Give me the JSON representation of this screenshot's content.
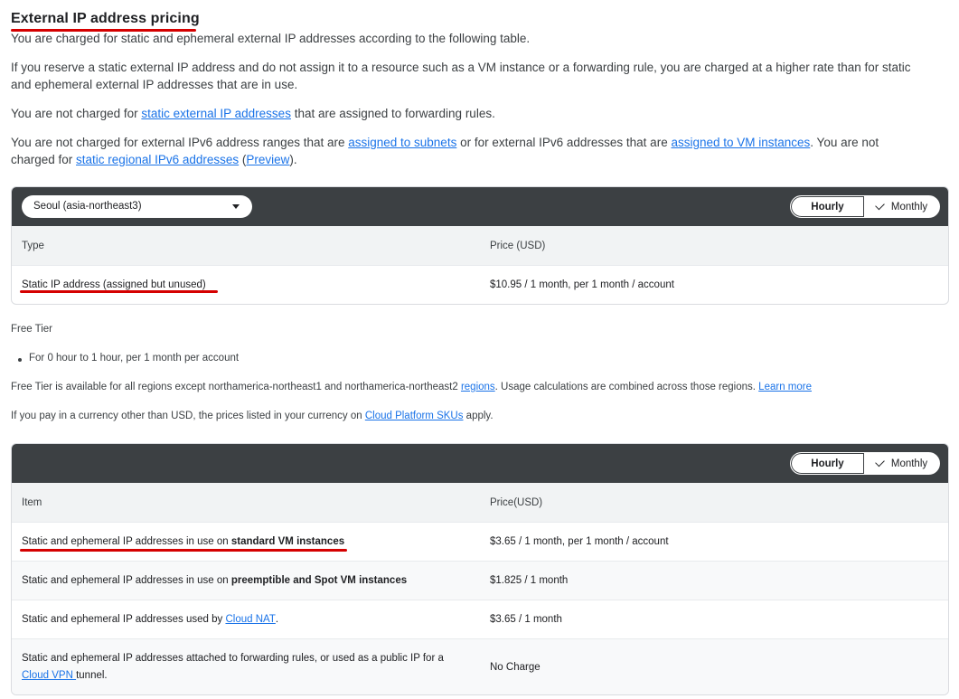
{
  "title": "External IP address pricing",
  "intro": {
    "p1": "You are charged for static and ephemeral external IP addresses according to the following table.",
    "p2": "If you reserve a static external IP address and do not assign it to a resource such as a VM instance or a forwarding rule, you are charged at a higher rate than for static and ephemeral external IP addresses that are in use.",
    "p3_pre": "You are not charged for ",
    "p3_link": "static external IP addresses",
    "p3_post": " that are assigned to forwarding rules.",
    "p4_pre": "You are not charged for external IPv6 address ranges that are ",
    "p4_link1": "assigned to subnets",
    "p4_mid": " or for external IPv6 addresses that are ",
    "p4_link2": "assigned to VM instances",
    "p4_mid2": ". You are not charged for ",
    "p4_link3": "static regional IPv6 addresses",
    "p4_paren_open": " (",
    "p4_link4": "Preview",
    "p4_end": ")."
  },
  "table1": {
    "region": "Seoul (asia-northeast3)",
    "toggle": {
      "hourly": "Hourly",
      "monthly": "Monthly"
    },
    "headers": [
      "Type",
      "Price (USD)"
    ],
    "rows": [
      {
        "type": "Static IP address (assigned but unused)",
        "price": "$10.95 / 1 month, per 1 month / account"
      }
    ]
  },
  "free_tier": {
    "label": "Free Tier",
    "bullet": "For 0 hour to 1 hour, per 1 month per account",
    "note_pre": "Free Tier is available for all regions except northamerica-northeast1 and northamerica-northeast2 ",
    "note_link1": "regions",
    "note_mid": ". Usage calculations are combined across those regions. ",
    "note_link2": "Learn more",
    "currency_pre": "If you pay in a currency other than USD, the prices listed in your currency on ",
    "currency_link": "Cloud Platform SKUs",
    "currency_post": " apply."
  },
  "table2": {
    "toggle": {
      "hourly": "Hourly",
      "monthly": "Monthly"
    },
    "headers": [
      "Item",
      "Price(USD)"
    ],
    "rows": [
      {
        "pre": "Static and ephemeral IP addresses in use on ",
        "bold": "standard VM instances",
        "price": "$3.65 / 1 month, per 1 month / account"
      },
      {
        "pre": "Static and ephemeral IP addresses in use on ",
        "bold": "preemptible and Spot VM instances",
        "price": "$1.825 / 1 month"
      },
      {
        "pre": "Static and ephemeral IP addresses used by ",
        "link": "Cloud NAT",
        "post": ".",
        "price": "$3.65 / 1 month"
      },
      {
        "pre": "Static and ephemeral IP addresses attached to forwarding rules, or used as a public IP for a ",
        "link": "Cloud VPN ",
        "post": "tunnel.",
        "price": "No Charge"
      }
    ]
  },
  "colors": {
    "annotation_red": "#d50000",
    "toolbar": "#3c4043",
    "link": "#1a73e8"
  }
}
